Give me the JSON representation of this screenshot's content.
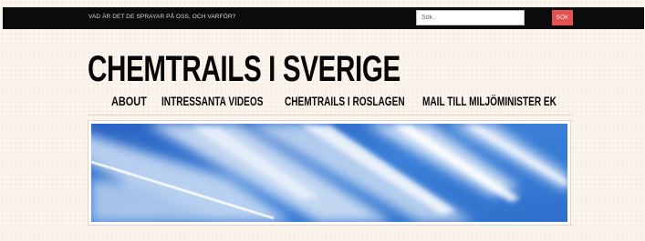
{
  "header": {
    "tagline": "VAD ÄR DET DE SPRAYAR PÅ OSS, OCH VARFÖR?",
    "search": {
      "placeholder": "Sök..",
      "button_label": "SÖK"
    }
  },
  "site": {
    "title": "CHEMTRAILS I SVERIGE"
  },
  "nav": {
    "items": [
      {
        "label": "ABOUT"
      },
      {
        "label": "INTRESSANTA VIDEOS"
      },
      {
        "label": "CHEMTRAILS I ROSLAGEN"
      },
      {
        "label": "MAIL TILL MILJÖMINISTER EK"
      }
    ]
  },
  "colors": {
    "topbar": "#0b0b0b",
    "search_button": "#e3524f",
    "page_background": "#fbf4ec",
    "sky": "#2f73cf"
  }
}
